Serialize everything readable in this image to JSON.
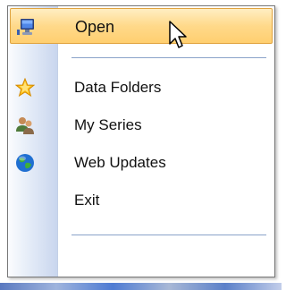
{
  "menu": {
    "items": [
      {
        "label": "Open",
        "icon": "monitor-icon",
        "highlighted": true
      },
      {
        "label": "Data Folders",
        "icon": "star-icon"
      },
      {
        "label": "My Series",
        "icon": "users-icon"
      },
      {
        "label": "Web Updates",
        "icon": "globe-icon"
      },
      {
        "label": "Exit",
        "icon": ""
      }
    ]
  },
  "colors": {
    "highlight_fill": "#ffd98a",
    "highlight_border": "#e0a33f",
    "separator": "#8aa3c9",
    "gutter": "#c9d6ee"
  }
}
